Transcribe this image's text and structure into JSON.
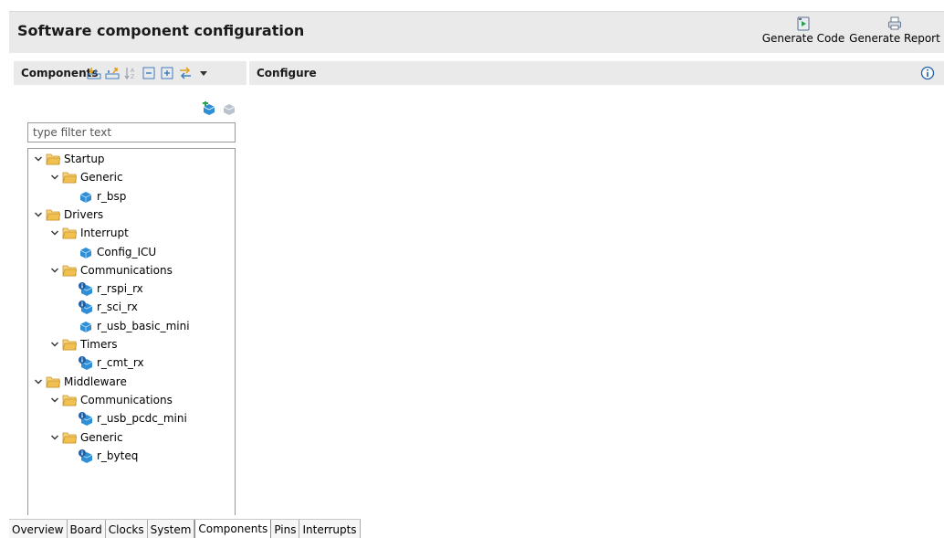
{
  "header": {
    "title": "Software component configuration",
    "generate_code_label": "Generate Code",
    "generate_report_label": "Generate Report"
  },
  "components_panel": {
    "title": "Components",
    "toolbar_icons": [
      "import-icon",
      "export-icon",
      "sort-icon",
      "collapse-all-icon",
      "expand-all-icon",
      "view-menu-icon",
      "dropdown-icon"
    ],
    "filter_placeholder": "type filter text",
    "tree": [
      {
        "label": "Startup",
        "level": 0,
        "type": "folder"
      },
      {
        "label": "Generic",
        "level": 1,
        "type": "folder"
      },
      {
        "label": "r_bsp",
        "level": 2,
        "type": "component"
      },
      {
        "label": "Drivers",
        "level": 0,
        "type": "folder"
      },
      {
        "label": "Interrupt",
        "level": 1,
        "type": "folder"
      },
      {
        "label": "Config_ICU",
        "level": 2,
        "type": "component"
      },
      {
        "label": "Communications",
        "level": 1,
        "type": "folder"
      },
      {
        "label": "r_rspi_rx",
        "level": 2,
        "type": "component-info"
      },
      {
        "label": "r_sci_rx",
        "level": 2,
        "type": "component-info"
      },
      {
        "label": "r_usb_basic_mini",
        "level": 2,
        "type": "component"
      },
      {
        "label": "Timers",
        "level": 1,
        "type": "folder"
      },
      {
        "label": "r_cmt_rx",
        "level": 2,
        "type": "component-info"
      },
      {
        "label": "Middleware",
        "level": 0,
        "type": "folder"
      },
      {
        "label": "Communications",
        "level": 1,
        "type": "folder"
      },
      {
        "label": "r_usb_pcdc_mini",
        "level": 2,
        "type": "component-info"
      },
      {
        "label": "Generic",
        "level": 1,
        "type": "folder"
      },
      {
        "label": "r_byteq",
        "level": 2,
        "type": "component-info"
      }
    ]
  },
  "configure_panel": {
    "title": "Configure"
  },
  "tabs": [
    {
      "label": "Overview",
      "active": false
    },
    {
      "label": "Board",
      "active": false
    },
    {
      "label": "Clocks",
      "active": false
    },
    {
      "label": "System",
      "active": false
    },
    {
      "label": "Components",
      "active": true
    },
    {
      "label": "Pins",
      "active": false
    },
    {
      "label": "Interrupts",
      "active": false
    }
  ],
  "colors": {
    "panel_bg": "#eaeaea",
    "folder": "#e8b54a",
    "component": "#2f8fd6",
    "info": "#1f5fa8"
  }
}
